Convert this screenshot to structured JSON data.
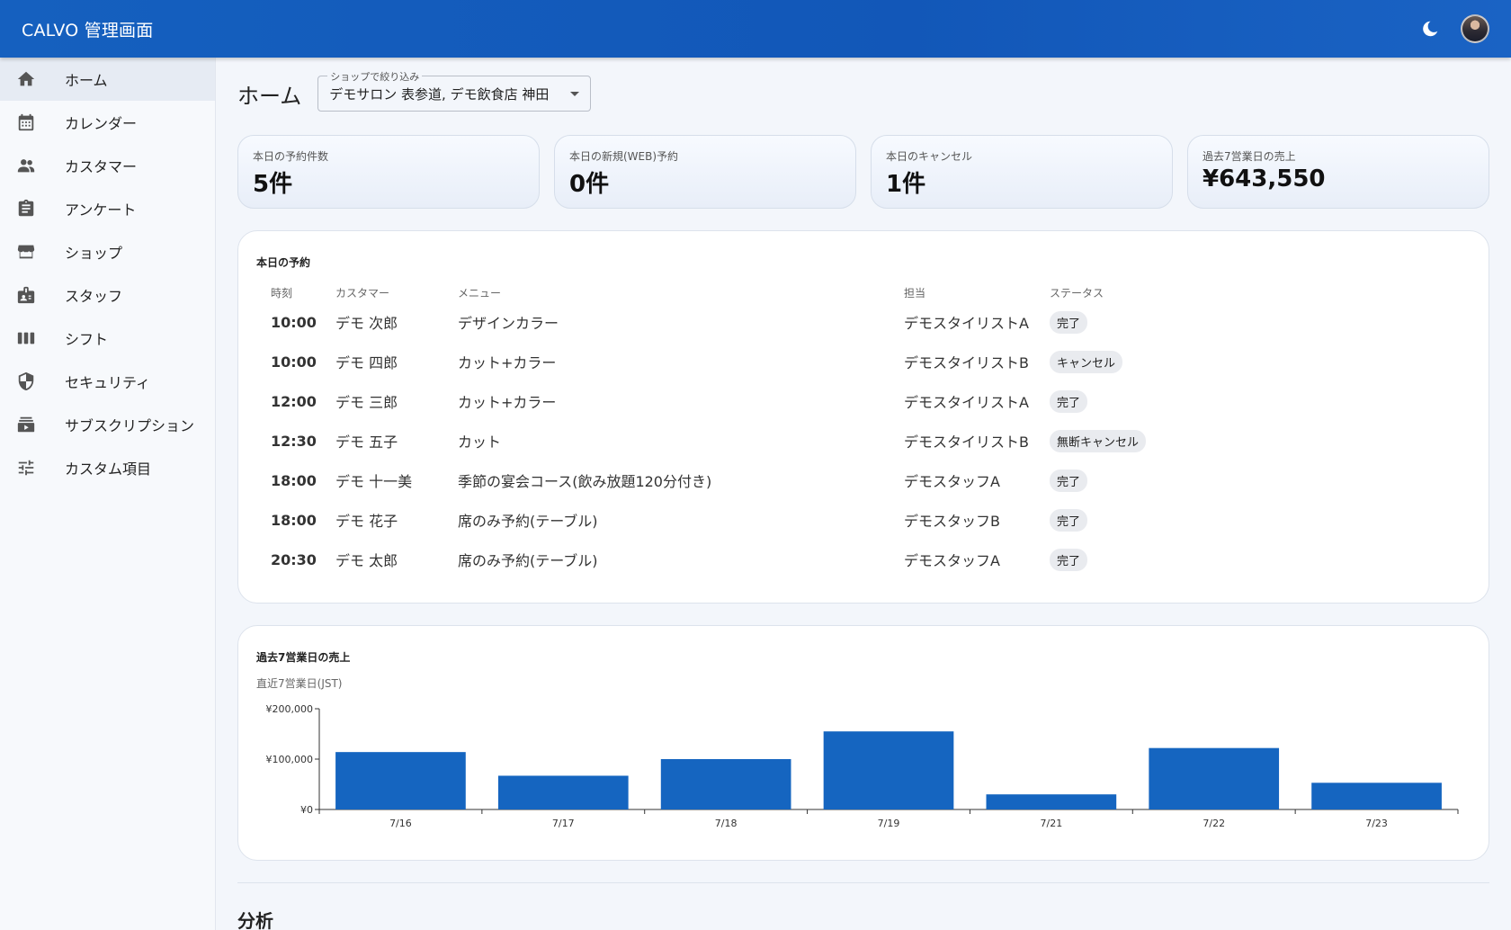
{
  "app": {
    "title": "CALVO 管理画面"
  },
  "header": {
    "theme_toggle_icon": "moon-icon",
    "avatar_icon": "user-avatar"
  },
  "sidebar": {
    "items": [
      {
        "label": "ホーム",
        "icon": "home-icon",
        "active": true
      },
      {
        "label": "カレンダー",
        "icon": "calendar-icon"
      },
      {
        "label": "カスタマー",
        "icon": "people-icon"
      },
      {
        "label": "アンケート",
        "icon": "clipboard-icon"
      },
      {
        "label": "ショップ",
        "icon": "storefront-icon"
      },
      {
        "label": "スタッフ",
        "icon": "badge-icon"
      },
      {
        "label": "シフト",
        "icon": "columns-icon"
      },
      {
        "label": "セキュリティ",
        "icon": "shield-icon"
      },
      {
        "label": "サブスクリプション",
        "icon": "subscriptions-icon"
      },
      {
        "label": "カスタム項目",
        "icon": "tune-icon"
      }
    ]
  },
  "page": {
    "title": "ホーム",
    "shop_filter": {
      "legend": "ショップで絞り込み",
      "value": "デモサロン 表参道, デモ飲食店 神田"
    }
  },
  "kpis": [
    {
      "label": "本日の予約件数",
      "value": "5件"
    },
    {
      "label": "本日の新規(WEB)予約",
      "value": "0件"
    },
    {
      "label": "本日のキャンセル",
      "value": "1件"
    },
    {
      "label": "過去7営業日の売上",
      "value": "¥643,550"
    }
  ],
  "reservations": {
    "title": "本日の予約",
    "columns": [
      "時刻",
      "カスタマー",
      "メニュー",
      "担当",
      "ステータス"
    ],
    "rows": [
      {
        "time": "10:00",
        "customer": "デモ 次郎",
        "menu": "デザインカラー",
        "staff": "デモスタイリストA",
        "status": "完了"
      },
      {
        "time": "10:00",
        "customer": "デモ 四郎",
        "menu": "カット+カラー",
        "staff": "デモスタイリストB",
        "status": "キャンセル"
      },
      {
        "time": "12:00",
        "customer": "デモ 三郎",
        "menu": "カット+カラー",
        "staff": "デモスタイリストA",
        "status": "完了"
      },
      {
        "time": "12:30",
        "customer": "デモ 五子",
        "menu": "カット",
        "staff": "デモスタイリストB",
        "status": "無断キャンセル"
      },
      {
        "time": "18:00",
        "customer": "デモ 十一美",
        "menu": "季節の宴会コース(飲み放題120分付き)",
        "staff": "デモスタッフA",
        "status": "完了"
      },
      {
        "time": "18:00",
        "customer": "デモ 花子",
        "menu": "席のみ予約(テーブル)",
        "staff": "デモスタッフB",
        "status": "完了"
      },
      {
        "time": "20:30",
        "customer": "デモ 太郎",
        "menu": "席のみ予約(テーブル)",
        "staff": "デモスタッフA",
        "status": "完了"
      }
    ]
  },
  "sales_chart": {
    "title": "過去7営業日の売上",
    "subtitle": "直近7営業日(JST)"
  },
  "chart_data": {
    "type": "bar",
    "categories": [
      "7/16",
      "7/17",
      "7/18",
      "7/19",
      "7/21",
      "7/22",
      "7/23"
    ],
    "values": [
      114000,
      67000,
      100000,
      155000,
      30000,
      122000,
      53000
    ],
    "ylim": [
      0,
      200000
    ],
    "yticks": [
      0,
      100000,
      200000
    ],
    "ytick_labels": [
      "¥0",
      "¥100,000",
      "¥200,000"
    ],
    "color": "#1565c0",
    "grid": false,
    "xlabel": "",
    "ylabel": ""
  },
  "analysis": {
    "title": "分析"
  }
}
